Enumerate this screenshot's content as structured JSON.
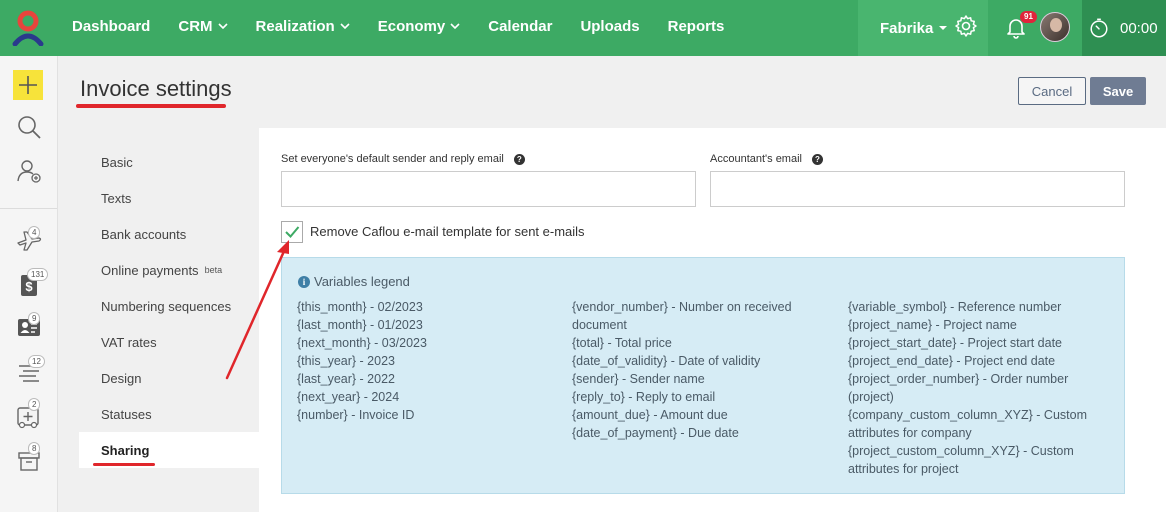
{
  "nav": {
    "items": [
      {
        "label": "Dashboard",
        "dropdown": false
      },
      {
        "label": "CRM",
        "dropdown": true
      },
      {
        "label": "Realization",
        "dropdown": true
      },
      {
        "label": "Economy",
        "dropdown": true
      },
      {
        "label": "Calendar",
        "dropdown": false
      },
      {
        "label": "Uploads",
        "dropdown": false
      },
      {
        "label": "Reports",
        "dropdown": false
      }
    ],
    "company": "Fabrika",
    "notifications_count": "91",
    "timer": "00:00"
  },
  "rail": {
    "badges": [
      "4",
      "131",
      "9",
      "12",
      "2",
      "8"
    ]
  },
  "header": {
    "title": "Invoice settings",
    "cancel_label": "Cancel",
    "save_label": "Save"
  },
  "menu": {
    "items": [
      {
        "label": "Basic"
      },
      {
        "label": "Texts"
      },
      {
        "label": "Bank accounts"
      },
      {
        "label": "Online payments",
        "tag": "beta"
      },
      {
        "label": "Numbering sequences"
      },
      {
        "label": "VAT rates"
      },
      {
        "label": "Design"
      },
      {
        "label": "Statuses"
      },
      {
        "label": "Sharing",
        "active": true
      }
    ]
  },
  "form": {
    "sender_label": "Set everyone's default sender and reply email",
    "sender_value": "",
    "accountant_label": "Accountant's email",
    "accountant_value": "",
    "checkbox_label": "Remove Caflou e-mail template for sent e-mails",
    "checkbox_checked": true
  },
  "legend": {
    "title": "Variables legend",
    "col1": [
      "{this_month} - 02/2023",
      "{last_month} - 01/2023",
      "{next_month} - 03/2023",
      "{this_year} - 2023",
      "{last_year} - 2022",
      "{next_year} - 2024",
      "{number} - Invoice ID"
    ],
    "col2": [
      "{vendor_number} - Number on received document",
      "{total} - Total price",
      "{date_of_validity} - Date of validity",
      "{sender} - Sender name",
      "{reply_to} - Reply to email",
      "{amount_due} - Amount due",
      "{date_of_payment} - Due date"
    ],
    "col3": [
      "{variable_symbol} - Reference number",
      "{project_name} - Project name",
      "{project_start_date} - Project start date",
      "{project_end_date} - Project end date",
      "{project_order_number} - Order number (project)",
      "{company_custom_column_XYZ} - Custom attributes for company",
      "{project_custom_column_XYZ} - Custom attributes for project"
    ]
  },
  "colors": {
    "topbar": "#3daa64",
    "accent_red": "#e0262b",
    "legend_bg": "#d6ecf5"
  }
}
